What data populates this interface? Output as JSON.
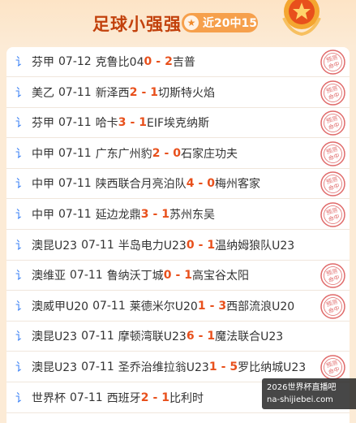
{
  "header": {
    "title": "足球小强强",
    "badge_icon": "star-icon",
    "badge_text": "近20中15",
    "medal_icon": "medal-star-icon"
  },
  "stamp_text": "预测命中",
  "matches": [
    {
      "league": "芬甲",
      "date": "07-12",
      "home": "克鲁比04",
      "home_score": "0",
      "away_score": "2",
      "away": "吉普",
      "hit": true
    },
    {
      "league": "美乙",
      "date": "07-11",
      "home": "新泽西",
      "home_score": "2",
      "away_score": "1",
      "away": "切斯特火焰",
      "hit": true
    },
    {
      "league": "芬甲",
      "date": "07-11",
      "home": "哈卡",
      "home_score": "3",
      "away_score": "1",
      "away": "EIF埃克纳斯",
      "hit": true
    },
    {
      "league": "中甲",
      "date": "07-11",
      "home": "广东广州豹",
      "home_score": "2",
      "away_score": "0",
      "away": "石家庄功夫",
      "hit": true
    },
    {
      "league": "中甲",
      "date": "07-11",
      "home": "陕西联合月亮泊队",
      "home_score": "4",
      "away_score": "0",
      "away": "梅州客家",
      "hit": true
    },
    {
      "league": "中甲",
      "date": "07-11",
      "home": "延边龙鼎",
      "home_score": "3",
      "away_score": "1",
      "away": "苏州东吴",
      "hit": true
    },
    {
      "league": "澳昆U23",
      "date": "07-11",
      "home": "半岛电力U23",
      "home_score": "0",
      "away_score": "1",
      "away": "温纳姆狼队U23",
      "hit": false
    },
    {
      "league": "澳维亚",
      "date": "07-11",
      "home": "鲁纳沃丁城",
      "home_score": "0",
      "away_score": "1",
      "away": "高宝谷太阳",
      "hit": true
    },
    {
      "league": "澳威甲U20",
      "date": "07-11",
      "home": "莱德米尔U20",
      "home_score": "1",
      "away_score": "3",
      "away": "西部流浪U20",
      "hit": true
    },
    {
      "league": "澳昆U23",
      "date": "07-11",
      "home": "摩顿湾联U23",
      "home_score": "6",
      "away_score": "1",
      "away": "魔法联合U23",
      "hit": false
    },
    {
      "league": "澳昆U23",
      "date": "07-11",
      "home": "圣乔治维拉翁U23",
      "home_score": "1",
      "away_score": "5",
      "away": "罗比纳城U23",
      "hit": true
    },
    {
      "league": "世界杯",
      "date": "07-11",
      "home": "西班牙",
      "home_score": "2",
      "away_score": "1",
      "away": "比利时",
      "hit": false
    }
  ],
  "watermark": {
    "line1": "2026世界杯直播吧",
    "line2": "na-shijiebei.com"
  },
  "colors": {
    "accent": "#e8501c",
    "title": "#c2410c",
    "badge": "#f6a04c",
    "stamp": "#e06a6a"
  }
}
